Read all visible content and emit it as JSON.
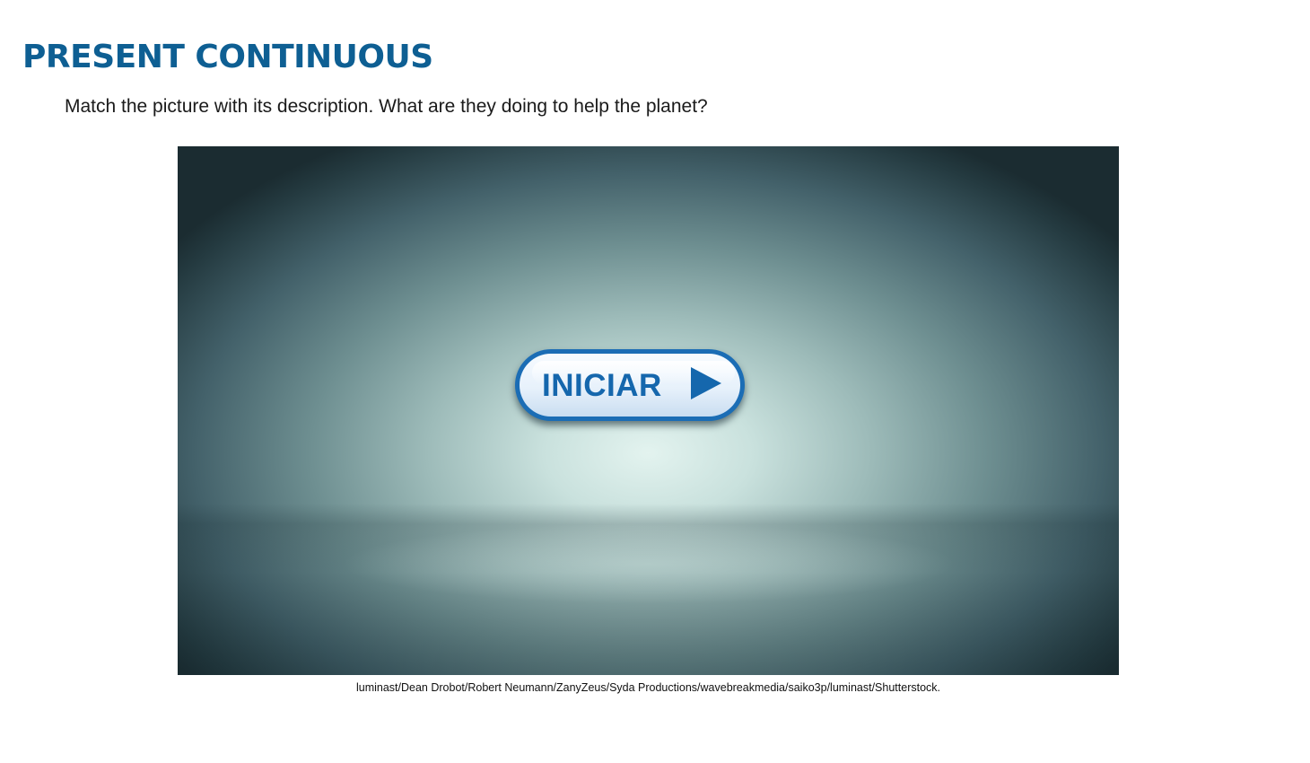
{
  "header": {
    "title": "PRESENT CONTINUOUS",
    "instruction": "Match the picture with its description. What are they doing to help the planet?"
  },
  "activity": {
    "start_button": {
      "label": "INICIAR",
      "icon": "play-icon",
      "color": "#1b6db5"
    }
  },
  "footer": {
    "credits": "luminast/Dean Drobot/Robert Neumann/ZanyZeus/Syda Productions/wavebreakmedia/saiko3p/luminast/Shutterstock."
  },
  "colors": {
    "title": "#0e5f93",
    "button_accent": "#1567ad"
  }
}
